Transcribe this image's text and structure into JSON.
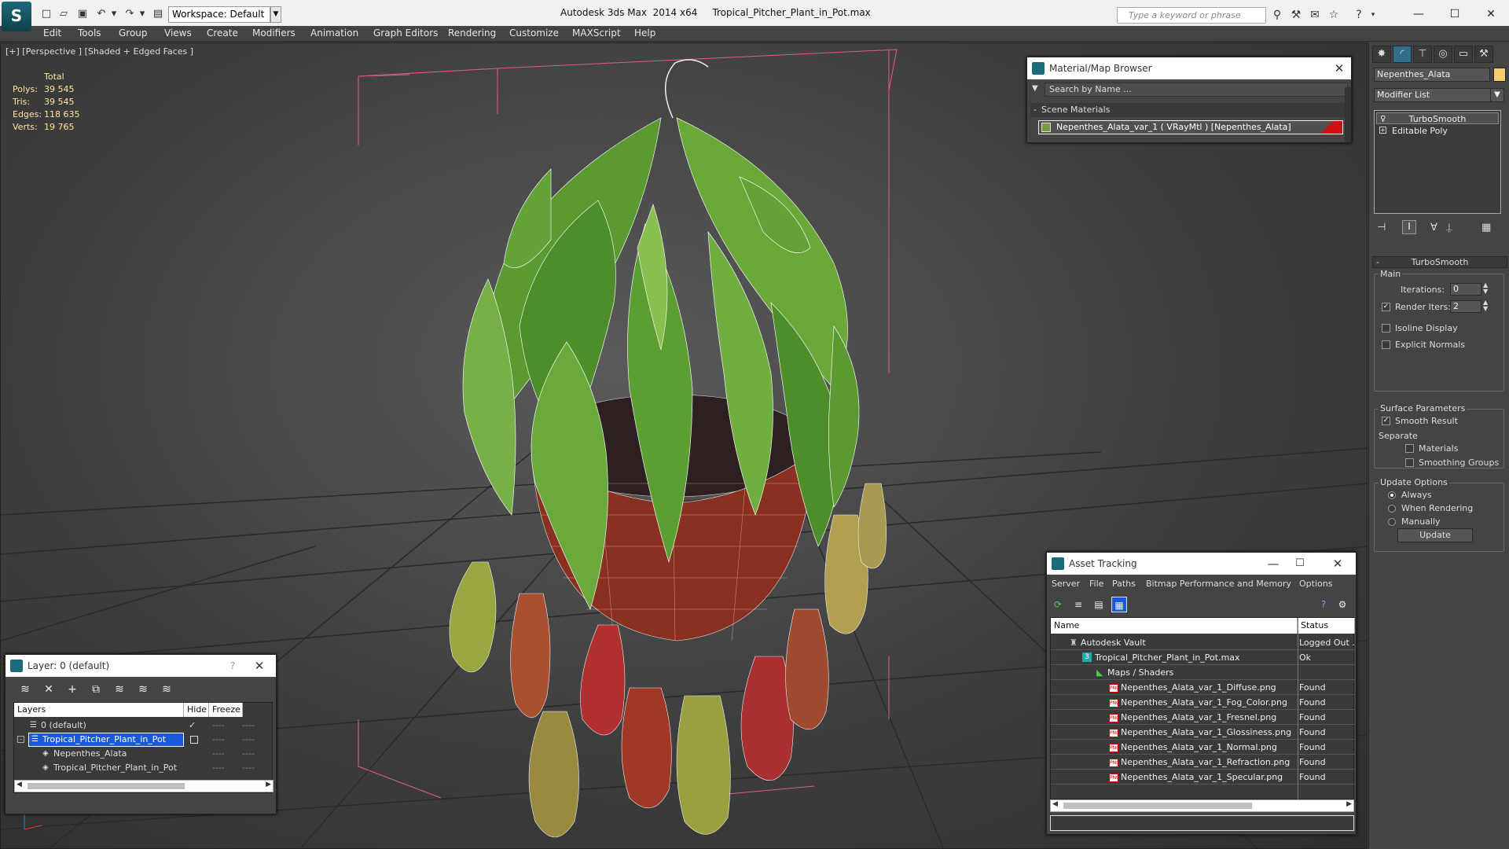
{
  "titlebar": {
    "workspace": "Workspace: Default",
    "app_name": "Autodesk 3ds Max  2014 x64",
    "file_name": "Tropical_Pitcher_Plant_in_Pot.max",
    "search_placeholder": "Type a keyword or phrase"
  },
  "menu": [
    "Edit",
    "Tools",
    "Group",
    "Views",
    "Create",
    "Modifiers",
    "Animation",
    "Graph Editors",
    "Rendering",
    "Customize",
    "MAXScript",
    "Help"
  ],
  "viewport": {
    "label": "[+] [Perspective ] [Shaded + Edged Faces ]",
    "stats": {
      "header": "Total",
      "rows": [
        {
          "label": "Polys:",
          "value": "39 545"
        },
        {
          "label": "Tris:",
          "value": "39 545"
        },
        {
          "label": "Edges:",
          "value": "118 635"
        },
        {
          "label": "Verts:",
          "value": "19 765"
        }
      ]
    }
  },
  "material_browser": {
    "title": "Material/Map Browser",
    "search": "Search by Name ...",
    "section": "Scene Materials",
    "material": "Nepenthes_Alata_var_1  ( VRayMtl )  [Nepenthes_Alata]",
    "swatch_color": "#d01010"
  },
  "command_panel": {
    "object_name": "Nepenthes_Alata",
    "object_color": "#f2cf6b",
    "modifier_list": "Modifier List",
    "stack": [
      "TurboSmooth",
      "Editable Poly"
    ],
    "rollout": "TurboSmooth",
    "main_group": "Main",
    "iterations_label": "Iterations:",
    "iterations_value": "0",
    "render_iters_label": "Render Iters:",
    "render_iters_value": "2",
    "isoline": "Isoline Display",
    "explicit_normals": "Explicit Normals",
    "surface_group": "Surface Parameters",
    "smooth_result": "Smooth Result",
    "separate": "Separate",
    "materials": "Materials",
    "smoothing_groups": "Smoothing Groups",
    "update_group": "Update Options",
    "always": "Always",
    "when_rendering": "When Rendering",
    "manually": "Manually",
    "update_button": "Update"
  },
  "layer_panel": {
    "title": "Layer: 0 (default)",
    "help": "?",
    "col_layers": "Layers",
    "col_hide": "Hide",
    "col_freeze": "Freeze",
    "rows": [
      {
        "name": "0 (default)"
      },
      {
        "name": "Tropical_Pitcher_Plant_in_Pot"
      },
      {
        "name": "Nepenthes_Alata"
      },
      {
        "name": "Tropical_Pitcher_Plant_in_Pot"
      }
    ]
  },
  "asset_tracking": {
    "title": "Asset Tracking",
    "menu": [
      "Server",
      "File",
      "Paths",
      "Bitmap Performance and Memory",
      "Options"
    ],
    "col_name": "Name",
    "col_status": "Status",
    "rows": [
      {
        "name": "Autodesk Vault",
        "status": "Logged Out ."
      },
      {
        "name": "Tropical_Pitcher_Plant_in_Pot.max",
        "status": "Ok"
      },
      {
        "name": "Maps / Shaders",
        "status": ""
      },
      {
        "name": "Nepenthes_Alata_var_1_Diffuse.png",
        "status": "Found"
      },
      {
        "name": "Nepenthes_Alata_var_1_Fog_Color.png",
        "status": "Found"
      },
      {
        "name": "Nepenthes_Alata_var_1_Fresnel.png",
        "status": "Found"
      },
      {
        "name": "Nepenthes_Alata_var_1_Glossiness.png",
        "status": "Found"
      },
      {
        "name": "Nepenthes_Alata_var_1_Normal.png",
        "status": "Found"
      },
      {
        "name": "Nepenthes_Alata_var_1_Refraction.png",
        "status": "Found"
      },
      {
        "name": "Nepenthes_Alata_var_1_Specular.png",
        "status": "Found"
      }
    ]
  }
}
